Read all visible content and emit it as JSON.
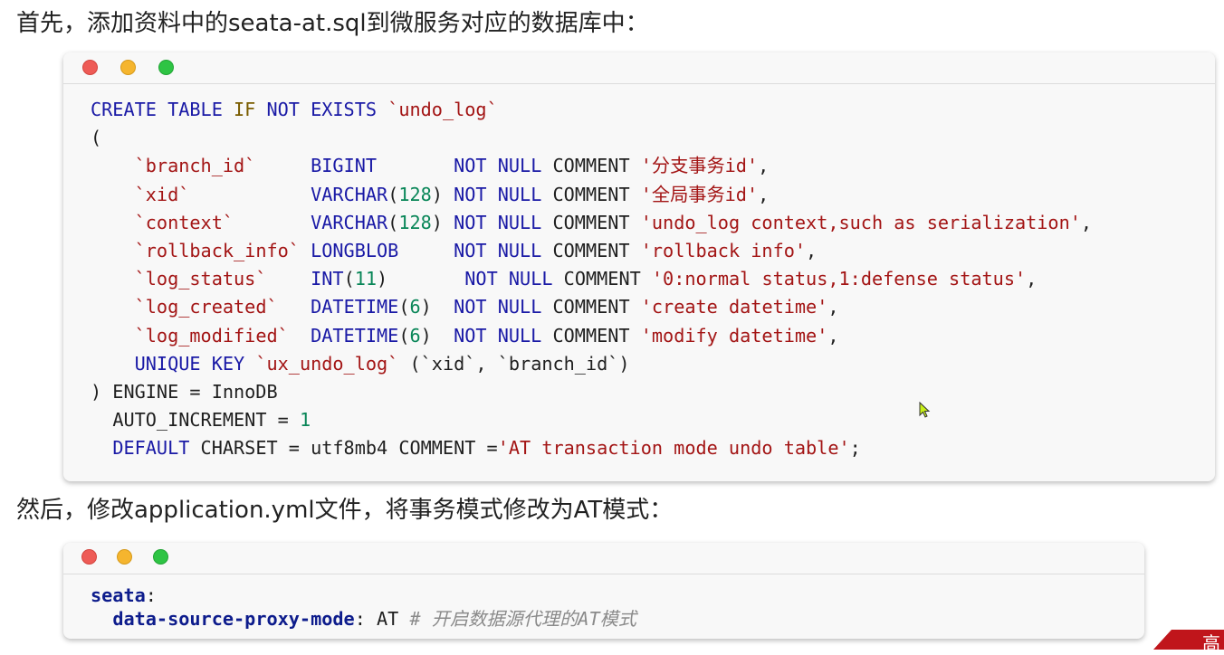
{
  "paragraph1": "首先，添加资料中的seata-at.sql到微服务对应的数据库中：",
  "paragraph2": "然后，修改application.yml文件，将事务模式修改为AT模式：",
  "sql": {
    "l1": {
      "a": "CREATE TABLE",
      "b": "IF",
      "c": "NOT EXISTS",
      "d": "`undo_log`"
    },
    "l2": "(",
    "rows": [
      {
        "name": "`branch_id`",
        "pad1": "     ",
        "type": "BIGINT",
        "typearg": "",
        "pad2": "       ",
        "nn": "NOT NULL",
        "cm": "COMMENT",
        "str": "'分支事务id'",
        "end": ","
      },
      {
        "name": "`xid`",
        "pad1": "           ",
        "type": "VARCHAR",
        "typearg": "128",
        "pad2": " ",
        "nn": "NOT NULL",
        "cm": "COMMENT",
        "str": "'全局事务id'",
        "end": ","
      },
      {
        "name": "`context`",
        "pad1": "       ",
        "type": "VARCHAR",
        "typearg": "128",
        "pad2": " ",
        "nn": "NOT NULL",
        "cm": "COMMENT",
        "str": "'undo_log context,such as serialization'",
        "end": ","
      },
      {
        "name": "`rollback_info`",
        "pad1": " ",
        "type": "LONGBLOB",
        "typearg": "",
        "pad2": "     ",
        "nn": "NOT NULL",
        "cm": "COMMENT",
        "str": "'rollback info'",
        "end": ","
      },
      {
        "name": "`log_status`",
        "pad1": "    ",
        "type": "INT",
        "typearg": "11",
        "pad2": "       ",
        "nn": "NOT NULL",
        "cm": "COMMENT",
        "str": "'0:normal status,1:defense status'",
        "end": ","
      },
      {
        "name": "`log_created`",
        "pad1": "   ",
        "type": "DATETIME",
        "typearg": "6",
        "pad2": "  ",
        "nn": "NOT NULL",
        "cm": "COMMENT",
        "str": "'create datetime'",
        "end": ","
      },
      {
        "name": "`log_modified`",
        "pad1": "  ",
        "type": "DATETIME",
        "typearg": "6",
        "pad2": "  ",
        "nn": "NOT NULL",
        "cm": "COMMENT",
        "str": "'modify datetime'",
        "end": ","
      }
    ],
    "unique": {
      "kw": "UNIQUE KEY",
      "name": "`ux_undo_log`",
      "rest1": " (`xid`, `branch_id`)"
    },
    "engine": ") ENGINE = InnoDB",
    "autoinc": {
      "a": "AUTO_INCREMENT = ",
      "b": "1"
    },
    "charset": {
      "a": "DEFAULT",
      "b": " CHARSET = utf8mb4 COMMENT =",
      "c": "'AT transaction mode undo table'",
      "d": ";"
    }
  },
  "yaml": {
    "root": "seata",
    "key": "data-source-proxy-mode",
    "value": "AT",
    "comment": "# 开启数据源代理的AT模式"
  },
  "corner_text": "高"
}
